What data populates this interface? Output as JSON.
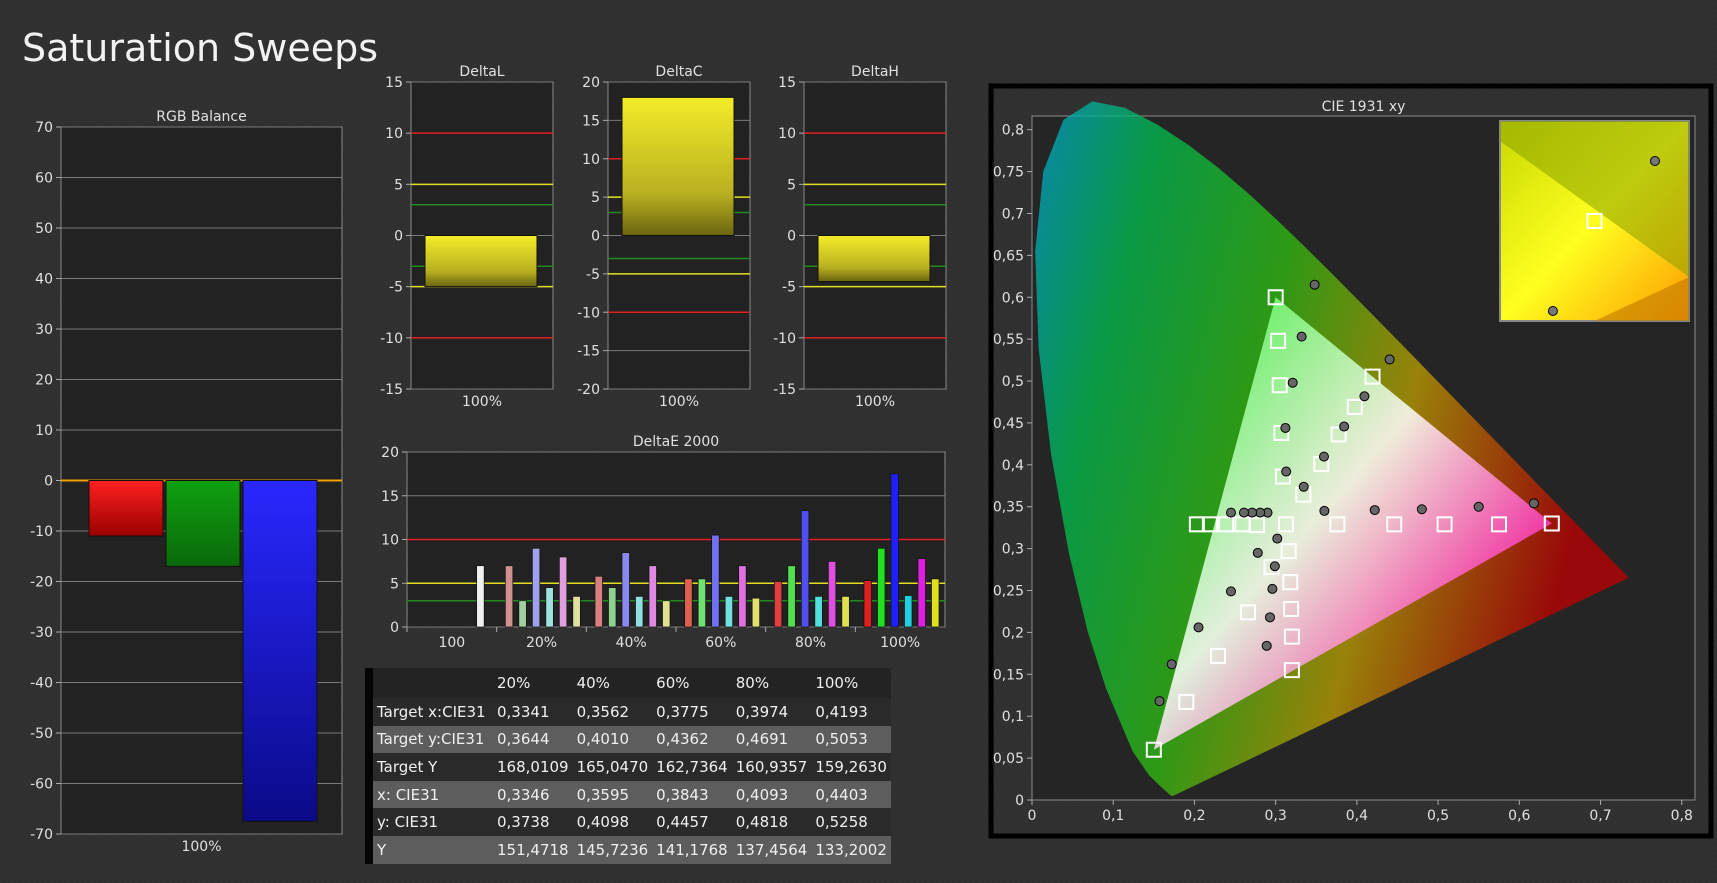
{
  "page": {
    "title": "Saturation Sweeps"
  },
  "rgb_balance": {
    "title": "RGB Balance",
    "yticks": [
      70,
      60,
      50,
      40,
      30,
      20,
      10,
      0,
      -10,
      -20,
      -30,
      -40,
      -50,
      -60,
      -70
    ],
    "ylim": [
      -70,
      70
    ],
    "xlabel": "100%",
    "colors": {
      "red": "#ff1010",
      "green": "#10a010",
      "blue": "#1818ff",
      "zero": "#f0a000"
    }
  },
  "delta_l": {
    "title": "DeltaL",
    "yticks": [
      15,
      10,
      5,
      0,
      -5,
      -10,
      -15
    ],
    "ylim": [
      -15,
      15
    ],
    "xlabel": "100%"
  },
  "delta_c": {
    "title": "DeltaC",
    "yticks": [
      20,
      15,
      10,
      5,
      0,
      -5,
      -10,
      -15,
      -20
    ],
    "ylim": [
      -20,
      20
    ],
    "xlabel": "100%"
  },
  "delta_h": {
    "title": "DeltaH",
    "yticks": [
      15,
      10,
      5,
      0,
      -5,
      -10,
      -15
    ],
    "ylim": [
      -15,
      15
    ],
    "xlabel": "100%"
  },
  "delta_e": {
    "title": "DeltaE 2000",
    "yticks": [
      20,
      15,
      10,
      5,
      0
    ],
    "ylim": [
      0,
      20
    ],
    "xlabels": [
      "100",
      "20%",
      "40%",
      "60%",
      "80%",
      "100%"
    ]
  },
  "cie": {
    "title": "CIE 1931 xy",
    "xticks": [
      "0",
      "0,1",
      "0,2",
      "0,3",
      "0,4",
      "0,5",
      "0,6",
      "0,7",
      "0,8"
    ],
    "yticks": [
      "0,8",
      "0,75",
      "0,7",
      "0,65",
      "0,6",
      "0,55",
      "0,5",
      "0,45",
      "0,4",
      "0,35",
      "0,3",
      "0,25",
      "0,2",
      "0,15",
      "0,1",
      "0,05",
      "0"
    ]
  },
  "table": {
    "headers": [
      "",
      "20%",
      "40%",
      "60%",
      "80%",
      "100%"
    ],
    "rows": [
      {
        "label": "Target x:CIE31",
        "values": [
          "0,3341",
          "0,3562",
          "0,3775",
          "0,3974",
          "0,4193"
        ]
      },
      {
        "label": "Target y:CIE31",
        "values": [
          "0,3644",
          "0,4010",
          "0,4362",
          "0,4691",
          "0,5053"
        ]
      },
      {
        "label": "Target Y",
        "values": [
          "168,0109",
          "165,0470",
          "162,7364",
          "160,9357",
          "159,2630"
        ]
      },
      {
        "label": "x: CIE31",
        "values": [
          "0,3346",
          "0,3595",
          "0,3843",
          "0,4093",
          "0,4403"
        ]
      },
      {
        "label": "y: CIE31",
        "values": [
          "0,3738",
          "0,4098",
          "0,4457",
          "0,4818",
          "0,5258"
        ]
      },
      {
        "label": "Y",
        "values": [
          "151,4718",
          "145,7236",
          "141,1768",
          "137,4564",
          "133,2002"
        ]
      }
    ]
  },
  "chart_data": [
    {
      "type": "bar",
      "title": "RGB Balance",
      "categories": [
        "100%"
      ],
      "series": [
        {
          "name": "R",
          "color": "#ff1010",
          "values": [
            -11
          ]
        },
        {
          "name": "G",
          "color": "#10a010",
          "values": [
            -17
          ]
        },
        {
          "name": "B",
          "color": "#1818ff",
          "values": [
            -67.5
          ]
        }
      ],
      "ylim": [
        -70,
        70
      ],
      "grid": true
    },
    {
      "type": "bar",
      "title": "DeltaL",
      "categories": [
        "100%"
      ],
      "values": [
        -5
      ],
      "ylim": [
        -15,
        15
      ],
      "reference_lines": [
        10,
        5,
        3,
        -3,
        -5,
        -10
      ]
    },
    {
      "type": "bar",
      "title": "DeltaC",
      "categories": [
        "100%"
      ],
      "values": [
        18
      ],
      "ylim": [
        -20,
        20
      ],
      "reference_lines": [
        10,
        5,
        3,
        -3,
        -5,
        -10
      ]
    },
    {
      "type": "bar",
      "title": "DeltaH",
      "categories": [
        "100%"
      ],
      "values": [
        -4.5
      ],
      "ylim": [
        -15,
        15
      ],
      "reference_lines": [
        10,
        5,
        3,
        -3,
        -5,
        -10
      ]
    },
    {
      "type": "bar",
      "title": "DeltaE 2000",
      "categories": [
        "100",
        "20%",
        "40%",
        "60%",
        "80%",
        "100%"
      ],
      "groups": [
        {
          "category": "100",
          "bars": [
            {
              "color": "#f0f0f0",
              "value": 7
            }
          ]
        },
        {
          "category": "20%",
          "bars": [
            {
              "color": "#d09090",
              "value": 7
            },
            {
              "color": "#a0d0a0",
              "value": 3
            },
            {
              "color": "#a0a0ee",
              "value": 9
            },
            {
              "color": "#a0e0e0",
              "value": 4.5
            },
            {
              "color": "#e0a0e0",
              "value": 8
            },
            {
              "color": "#e0e0a0",
              "value": 3.5
            }
          ]
        },
        {
          "category": "40%",
          "bars": [
            {
              "color": "#d88080",
              "value": 5.8
            },
            {
              "color": "#90d090",
              "value": 4.5
            },
            {
              "color": "#8888ee",
              "value": 8.5
            },
            {
              "color": "#90e0e0",
              "value": 3.5
            },
            {
              "color": "#e088e0",
              "value": 7
            },
            {
              "color": "#e0e090",
              "value": 3
            }
          ]
        },
        {
          "category": "60%",
          "bars": [
            {
              "color": "#e06050",
              "value": 5.5
            },
            {
              "color": "#70e070",
              "value": 5.5
            },
            {
              "color": "#7070f0",
              "value": 10.5
            },
            {
              "color": "#70e0e0",
              "value": 3.5
            },
            {
              "color": "#e070e0",
              "value": 7
            },
            {
              "color": "#e0e070",
              "value": 3.3
            }
          ]
        },
        {
          "category": "80%",
          "bars": [
            {
              "color": "#e04040",
              "value": 5.2
            },
            {
              "color": "#50e050",
              "value": 7
            },
            {
              "color": "#5050f0",
              "value": 13.3
            },
            {
              "color": "#50e0e0",
              "value": 3.5
            },
            {
              "color": "#e050e0",
              "value": 7.5
            },
            {
              "color": "#e0e050",
              "value": 3.5
            }
          ]
        },
        {
          "category": "100%",
          "bars": [
            {
              "color": "#e02020",
              "value": 5.3
            },
            {
              "color": "#20e020",
              "value": 9
            },
            {
              "color": "#2020ff",
              "value": 17.5
            },
            {
              "color": "#20d0e0",
              "value": 3.6
            },
            {
              "color": "#e020e0",
              "value": 7.8
            },
            {
              "color": "#e0e020",
              "value": 5.5
            }
          ]
        }
      ],
      "ylim": [
        0,
        20
      ],
      "reference_lines": [
        10,
        5,
        3
      ]
    },
    {
      "type": "scatter",
      "title": "CIE 1931 xy",
      "xlim": [
        0,
        0.8
      ],
      "ylim": [
        0,
        0.8
      ],
      "gamut_triangle": [
        [
          0.64,
          0.33
        ],
        [
          0.3,
          0.6
        ],
        [
          0.15,
          0.06
        ]
      ],
      "white_point": [
        0.3127,
        0.329
      ],
      "series": [
        {
          "name": "targets",
          "marker": "square",
          "points": [
            [
              0.3127,
              0.329
            ],
            [
              0.3341,
              0.3644
            ],
            [
              0.3562,
              0.401
            ],
            [
              0.3775,
              0.4362
            ],
            [
              0.3974,
              0.4691
            ],
            [
              0.4193,
              0.5053
            ],
            [
              0.309,
              0.386
            ],
            [
              0.307,
              0.438
            ],
            [
              0.305,
              0.495
            ],
            [
              0.303,
              0.548
            ],
            [
              0.3,
              0.6
            ],
            [
              0.376,
              0.329
            ],
            [
              0.446,
              0.329
            ],
            [
              0.508,
              0.329
            ],
            [
              0.575,
              0.329
            ],
            [
              0.64,
              0.33
            ],
            [
              0.277,
              0.328
            ],
            [
              0.259,
              0.329
            ],
            [
              0.239,
              0.329
            ],
            [
              0.219,
              0.329
            ],
            [
              0.203,
              0.329
            ],
            [
              0.295,
              0.278
            ],
            [
              0.266,
              0.224
            ],
            [
              0.229,
              0.172
            ],
            [
              0.19,
              0.117
            ],
            [
              0.15,
              0.06
            ],
            [
              0.316,
              0.297
            ],
            [
              0.318,
              0.26
            ],
            [
              0.319,
              0.228
            ],
            [
              0.32,
              0.195
            ],
            [
              0.32,
              0.155
            ]
          ]
        },
        {
          "name": "measured",
          "marker": "circle",
          "points": [
            [
              0.3346,
              0.3738
            ],
            [
              0.3595,
              0.4098
            ],
            [
              0.3843,
              0.4457
            ],
            [
              0.4093,
              0.4818
            ],
            [
              0.4403,
              0.5258
            ],
            [
              0.313,
              0.392
            ],
            [
              0.312,
              0.444
            ],
            [
              0.321,
              0.498
            ],
            [
              0.332,
              0.553
            ],
            [
              0.348,
              0.615
            ],
            [
              0.36,
              0.345
            ],
            [
              0.422,
              0.346
            ],
            [
              0.48,
              0.347
            ],
            [
              0.55,
              0.35
            ],
            [
              0.618,
              0.354
            ],
            [
              0.29,
              0.343
            ],
            [
              0.281,
              0.343
            ],
            [
              0.271,
              0.343
            ],
            [
              0.261,
              0.343
            ],
            [
              0.245,
              0.343
            ],
            [
              0.278,
              0.295
            ],
            [
              0.245,
              0.249
            ],
            [
              0.205,
              0.206
            ],
            [
              0.172,
              0.162
            ],
            [
              0.157,
              0.118
            ],
            [
              0.302,
              0.312
            ],
            [
              0.299,
              0.279
            ],
            [
              0.296,
              0.252
            ],
            [
              0.293,
              0.218
            ],
            [
              0.289,
              0.184
            ]
          ]
        },
        {
          "name": "inset",
          "marker": "mixed",
          "points": [
            [
              0.82,
              0.8
            ],
            [
              0.5,
              0.5
            ],
            [
              0.28,
              0.05
            ]
          ]
        }
      ]
    }
  ]
}
